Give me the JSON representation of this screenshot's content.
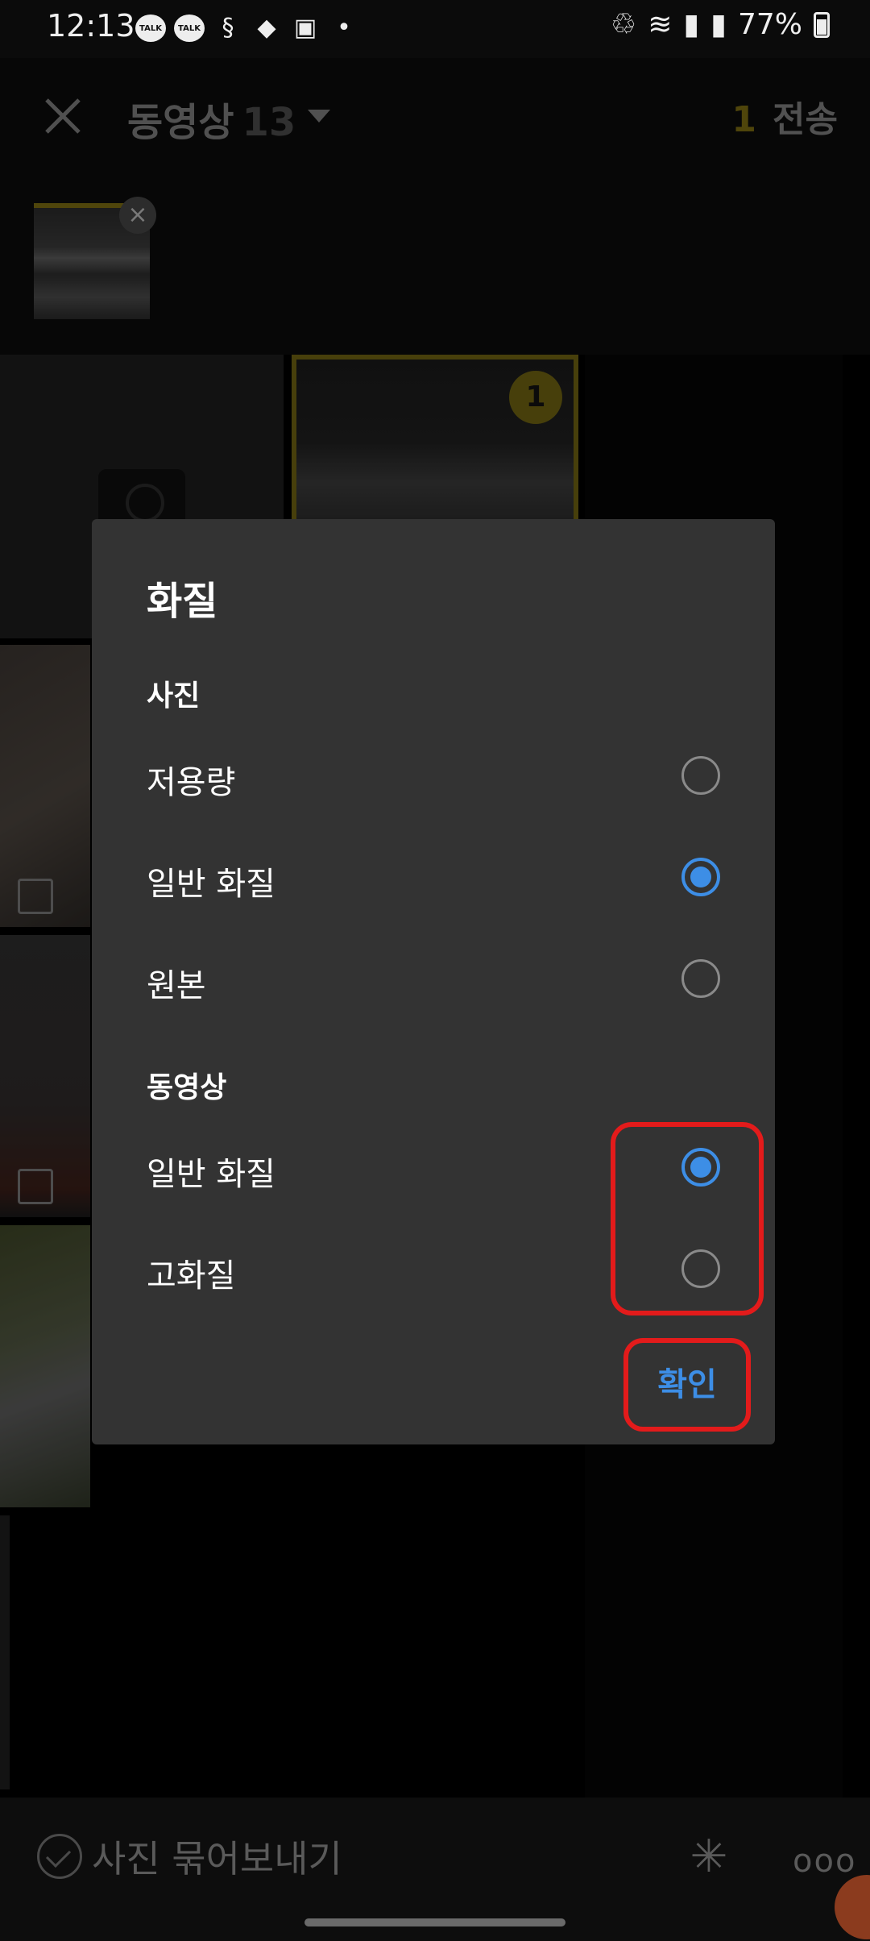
{
  "status_bar": {
    "time": "12:13",
    "notification_icons": [
      "TALK",
      "TALK"
    ],
    "battery": "77%"
  },
  "header": {
    "title": "동영상",
    "count": "13",
    "send_count": "1",
    "send_label": "전송"
  },
  "grid": {
    "selected_order": "1"
  },
  "dialog": {
    "title": "화질",
    "photo_section": "사진",
    "photo_options": [
      {
        "label": "저용량",
        "checked": false
      },
      {
        "label": "일반 화질",
        "checked": true
      },
      {
        "label": "원본",
        "checked": false
      }
    ],
    "video_section": "동영상",
    "video_options": [
      {
        "label": "일반 화질",
        "checked": true
      },
      {
        "label": "고화질",
        "checked": false
      }
    ],
    "confirm_label": "확인"
  },
  "bottom_bar": {
    "bundle_label": "사진 묶어보내기"
  },
  "colors": {
    "accent_blue": "#3d8ee6",
    "highlight_red": "#e31b1b",
    "selection_gold": "#6e6212",
    "dialog_bg": "#333333"
  }
}
